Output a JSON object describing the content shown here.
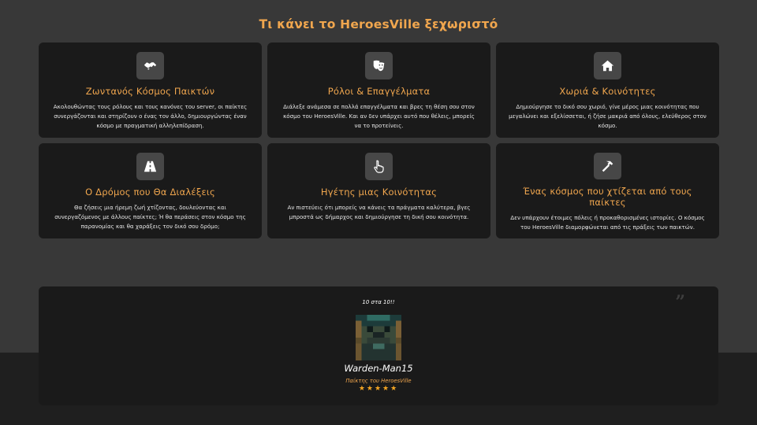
{
  "section": {
    "title": "Τι κάνει το HeroesVille ξεχωριστό"
  },
  "features": [
    {
      "icon": "handshake-icon",
      "title": "Ζωντανός Κόσμος Παικτών",
      "text": "Ακολουθώντας τους ρόλους και τους κανόνες του server, οι παίκτες συνεργάζονται και στηρίζουν ο ένας τον άλλο, δημιουργώντας έναν κόσμο με πραγματική αλληλεπίδραση."
    },
    {
      "icon": "theater-masks-icon",
      "title": "Ρόλοι & Επαγγέλματα",
      "text": "Διάλεξε ανάμεσα σε πολλά επαγγέλματα και βρες τη θέση σου στον κόσμο του HeroesVille. Και αν δεν υπάρχει αυτό που θέλεις, μπορείς να το προτείνεις."
    },
    {
      "icon": "home-icon",
      "title": "Χωριά & Κοινότητες",
      "text": "Δημιούργησε το δικό σου χωριό, γίνε μέρος μιας κοινότητας που μεγαλώνει και εξελίσσεται, ή ζήσε μακριά από όλους, ελεύθερος στον κόσμο."
    },
    {
      "icon": "road-icon",
      "title": "Ο Δρόμος που Θα Διαλέξεις",
      "text": "Θα ζήσεις μια ήρεμη ζωή χτίζοντας, δουλεύοντας και συνεργαζόμενος με άλλους παίκτες; Ή θα περάσεις στον κόσμο της παρανομίας και θα χαράξεις τον δικό σου δρόμο;"
    },
    {
      "icon": "pointer-hand-icon",
      "title": "Ηγέτης μιας Κοινότητας",
      "text": "Αν πιστεύεις ότι μπορείς να κάνεις τα πράγματα καλύτερα, βγες μπροστά ως δήμαρχος και δημιούργησε τη δική σου κοινότητα."
    },
    {
      "icon": "hammer-icon",
      "title": "Ένας κόσμος που χτίζεται από τους παίκτες",
      "text": "Δεν υπάρχουν έτοιμες πόλεις ή προκαθορισμένες ιστορίες. Ο κόσμος του HeroesVille διαμορφώνεται από τις πράξεις των παικτών."
    }
  ],
  "testimonial": {
    "quote": "10 στα 10!!",
    "quote_icon": "quote-icon",
    "author": "Warden-Man15",
    "role": "Παίκτης του HeroesVille",
    "rating": 5,
    "stars": "★★★★★"
  },
  "colors": {
    "accent": "#f0a64e",
    "page_bg": "#383838",
    "card_bg": "#1a1a1a",
    "icon_bg": "#474747",
    "star": "#f5a623"
  }
}
